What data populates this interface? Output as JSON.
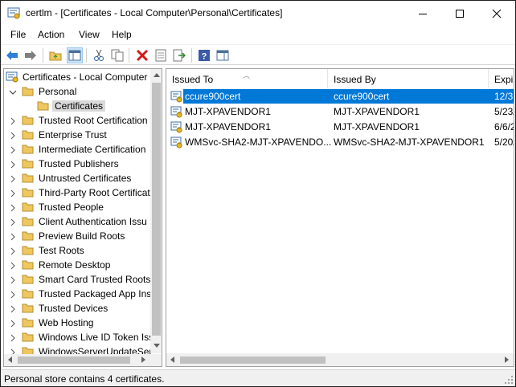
{
  "window": {
    "app_name": "certlm",
    "title": "certlm - [Certificates - Local Computer\\Personal\\Certificates]"
  },
  "menu": {
    "items": [
      "File",
      "Action",
      "View",
      "Help"
    ]
  },
  "toolbar": {
    "icons": [
      "back-arrow-icon",
      "forward-arrow-icon",
      "up-folder-icon",
      "show-hide-console-tree-icon",
      "cut-icon",
      "copy-icon",
      "delete-icon",
      "properties-icon",
      "export-list-icon",
      "help-icon",
      "action-pane-icon"
    ]
  },
  "tree": {
    "root": "Certificates - Local Computer",
    "personal": "Personal",
    "certificates": "Certificates",
    "stores": [
      "Trusted Root Certification",
      "Enterprise Trust",
      "Intermediate Certification",
      "Trusted Publishers",
      "Untrusted Certificates",
      "Third-Party Root Certificat",
      "Trusted People",
      "Client Authentication Issu",
      "Preview Build Roots",
      "Test Roots",
      "Remote Desktop",
      "Smart Card Trusted Roots",
      "Trusted Packaged App Ins",
      "Trusted Devices",
      "Web Hosting",
      "Windows Live ID Token Iss",
      "WindowsServerUpdateSer"
    ]
  },
  "list": {
    "columns": [
      "Issued To",
      "Issued By",
      "Expir"
    ],
    "rows": [
      {
        "issued_to": "ccure900cert",
        "issued_by": "ccure900cert",
        "expires": "12/3"
      },
      {
        "issued_to": "MJT-XPAVENDOR1",
        "issued_by": "MJT-XPAVENDOR1",
        "expires": "5/23/"
      },
      {
        "issued_to": "MJT-XPAVENDOR1",
        "issued_by": "MJT-XPAVENDOR1",
        "expires": "6/6/2"
      },
      {
        "issued_to": "WMSvc-SHA2-MJT-XPAVENDO...",
        "issued_by": "WMSvc-SHA2-MJT-XPAVENDOR1",
        "expires": "5/20/"
      }
    ],
    "selected_row": 0
  },
  "status": {
    "text": "Personal store contains 4 certificates."
  },
  "colors": {
    "selection": "#0078d7",
    "tree_selection": "#d9d9d9",
    "folder": "#f0c75e",
    "border": "#a0a0a0"
  }
}
